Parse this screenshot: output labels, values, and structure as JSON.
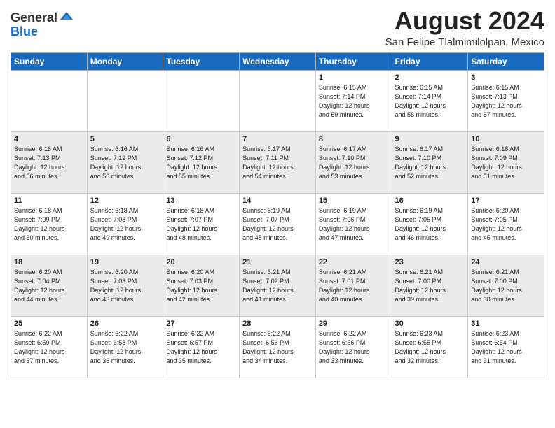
{
  "header": {
    "logo_general": "General",
    "logo_blue": "Blue",
    "month_year": "August 2024",
    "location": "San Felipe Tlalmimilolpan, Mexico"
  },
  "weekdays": [
    "Sunday",
    "Monday",
    "Tuesday",
    "Wednesday",
    "Thursday",
    "Friday",
    "Saturday"
  ],
  "weeks": [
    [
      {
        "day": "",
        "info": ""
      },
      {
        "day": "",
        "info": ""
      },
      {
        "day": "",
        "info": ""
      },
      {
        "day": "",
        "info": ""
      },
      {
        "day": "1",
        "info": "Sunrise: 6:15 AM\nSunset: 7:14 PM\nDaylight: 12 hours\nand 59 minutes."
      },
      {
        "day": "2",
        "info": "Sunrise: 6:15 AM\nSunset: 7:14 PM\nDaylight: 12 hours\nand 58 minutes."
      },
      {
        "day": "3",
        "info": "Sunrise: 6:15 AM\nSunset: 7:13 PM\nDaylight: 12 hours\nand 57 minutes."
      }
    ],
    [
      {
        "day": "4",
        "info": "Sunrise: 6:16 AM\nSunset: 7:13 PM\nDaylight: 12 hours\nand 56 minutes."
      },
      {
        "day": "5",
        "info": "Sunrise: 6:16 AM\nSunset: 7:12 PM\nDaylight: 12 hours\nand 56 minutes."
      },
      {
        "day": "6",
        "info": "Sunrise: 6:16 AM\nSunset: 7:12 PM\nDaylight: 12 hours\nand 55 minutes."
      },
      {
        "day": "7",
        "info": "Sunrise: 6:17 AM\nSunset: 7:11 PM\nDaylight: 12 hours\nand 54 minutes."
      },
      {
        "day": "8",
        "info": "Sunrise: 6:17 AM\nSunset: 7:10 PM\nDaylight: 12 hours\nand 53 minutes."
      },
      {
        "day": "9",
        "info": "Sunrise: 6:17 AM\nSunset: 7:10 PM\nDaylight: 12 hours\nand 52 minutes."
      },
      {
        "day": "10",
        "info": "Sunrise: 6:18 AM\nSunset: 7:09 PM\nDaylight: 12 hours\nand 51 minutes."
      }
    ],
    [
      {
        "day": "11",
        "info": "Sunrise: 6:18 AM\nSunset: 7:09 PM\nDaylight: 12 hours\nand 50 minutes."
      },
      {
        "day": "12",
        "info": "Sunrise: 6:18 AM\nSunset: 7:08 PM\nDaylight: 12 hours\nand 49 minutes."
      },
      {
        "day": "13",
        "info": "Sunrise: 6:18 AM\nSunset: 7:07 PM\nDaylight: 12 hours\nand 48 minutes."
      },
      {
        "day": "14",
        "info": "Sunrise: 6:19 AM\nSunset: 7:07 PM\nDaylight: 12 hours\nand 48 minutes."
      },
      {
        "day": "15",
        "info": "Sunrise: 6:19 AM\nSunset: 7:06 PM\nDaylight: 12 hours\nand 47 minutes."
      },
      {
        "day": "16",
        "info": "Sunrise: 6:19 AM\nSunset: 7:05 PM\nDaylight: 12 hours\nand 46 minutes."
      },
      {
        "day": "17",
        "info": "Sunrise: 6:20 AM\nSunset: 7:05 PM\nDaylight: 12 hours\nand 45 minutes."
      }
    ],
    [
      {
        "day": "18",
        "info": "Sunrise: 6:20 AM\nSunset: 7:04 PM\nDaylight: 12 hours\nand 44 minutes."
      },
      {
        "day": "19",
        "info": "Sunrise: 6:20 AM\nSunset: 7:03 PM\nDaylight: 12 hours\nand 43 minutes."
      },
      {
        "day": "20",
        "info": "Sunrise: 6:20 AM\nSunset: 7:03 PM\nDaylight: 12 hours\nand 42 minutes."
      },
      {
        "day": "21",
        "info": "Sunrise: 6:21 AM\nSunset: 7:02 PM\nDaylight: 12 hours\nand 41 minutes."
      },
      {
        "day": "22",
        "info": "Sunrise: 6:21 AM\nSunset: 7:01 PM\nDaylight: 12 hours\nand 40 minutes."
      },
      {
        "day": "23",
        "info": "Sunrise: 6:21 AM\nSunset: 7:00 PM\nDaylight: 12 hours\nand 39 minutes."
      },
      {
        "day": "24",
        "info": "Sunrise: 6:21 AM\nSunset: 7:00 PM\nDaylight: 12 hours\nand 38 minutes."
      }
    ],
    [
      {
        "day": "25",
        "info": "Sunrise: 6:22 AM\nSunset: 6:59 PM\nDaylight: 12 hours\nand 37 minutes."
      },
      {
        "day": "26",
        "info": "Sunrise: 6:22 AM\nSunset: 6:58 PM\nDaylight: 12 hours\nand 36 minutes."
      },
      {
        "day": "27",
        "info": "Sunrise: 6:22 AM\nSunset: 6:57 PM\nDaylight: 12 hours\nand 35 minutes."
      },
      {
        "day": "28",
        "info": "Sunrise: 6:22 AM\nSunset: 6:56 PM\nDaylight: 12 hours\nand 34 minutes."
      },
      {
        "day": "29",
        "info": "Sunrise: 6:22 AM\nSunset: 6:56 PM\nDaylight: 12 hours\nand 33 minutes."
      },
      {
        "day": "30",
        "info": "Sunrise: 6:23 AM\nSunset: 6:55 PM\nDaylight: 12 hours\nand 32 minutes."
      },
      {
        "day": "31",
        "info": "Sunrise: 6:23 AM\nSunset: 6:54 PM\nDaylight: 12 hours\nand 31 minutes."
      }
    ]
  ]
}
